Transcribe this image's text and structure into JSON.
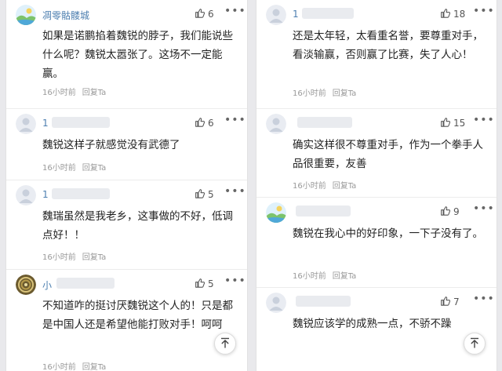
{
  "left_column": [
    {
      "username": "凋零骷髅城",
      "likes": "6",
      "text": "如果是诺鹏掐着魏锐的脖子，我们能说些什么呢？魏锐太嚣张了。这场不一定能赢。",
      "time": "16小时前",
      "reply": "回复Ta",
      "avatar": "landscape-avatar"
    },
    {
      "username": "1",
      "likes": "6",
      "text": "魏锐这样子就感觉没有武德了",
      "time": "16小时前",
      "reply": "回复Ta",
      "avatar": "default-avatar"
    },
    {
      "username": "1",
      "likes": "5",
      "text": "魏瑞虽然是我老乡，这事做的不好，低调点好！！",
      "time": "16小时前",
      "reply": "回复Ta",
      "avatar": "default-avatar"
    },
    {
      "username": "小",
      "likes": "5",
      "text": "不知道咋的挺讨厌魏锐这个人的！只是都是中国人还是希望他能打败对手！呵呵",
      "time": "16小时前",
      "reply": "回复Ta",
      "avatar": "spiral-avatar"
    }
  ],
  "right_column": [
    {
      "username": "1",
      "likes": "18",
      "text": "还是太年轻，太看重名誉，要尊重对手，看淡输赢，否则赢了比赛，失了人心！",
      "time": "16小时前",
      "reply": "回复Ta",
      "avatar": "default-avatar"
    },
    {
      "username": "",
      "likes": "15",
      "text": "确实这样很不尊重对手，作为一个拳手人品很重要，友善",
      "time": "16小时前",
      "reply": "回复Ta",
      "avatar": "default-avatar"
    },
    {
      "username": "",
      "likes": "9",
      "text": "魏锐在我心中的好印象，一下子没有了。",
      "time": "16小时前",
      "reply": "回复Ta",
      "avatar": "landscape-avatar"
    },
    {
      "username": "",
      "likes": "7",
      "text": "魏锐应该学的成熟一点，不骄不躁",
      "time": "",
      "reply": "",
      "avatar": "default-avatar"
    }
  ],
  "icons": {
    "like": "thumbs-up-icon",
    "more": "more-options-icon",
    "scroll_top": "arrow-up-icon"
  },
  "colors": {
    "username": "#4d7fb0",
    "meta": "#999999",
    "text": "#222222"
  }
}
